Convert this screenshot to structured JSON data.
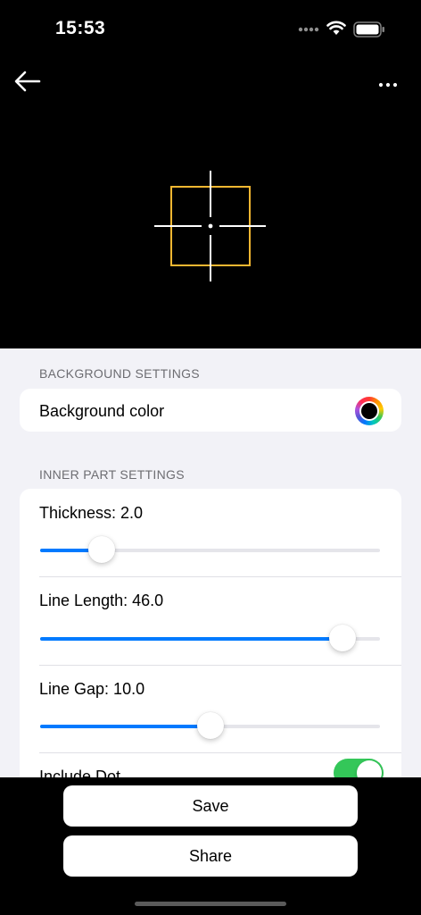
{
  "status_bar": {
    "time": "15:53"
  },
  "background_settings": {
    "header": "BACKGROUND SETTINGS",
    "background_color_label": "Background color",
    "background_color_value": "#000000"
  },
  "inner_part_settings": {
    "header": "INNER PART SETTINGS",
    "sliders": [
      {
        "label": "Thickness: 2.0",
        "fraction": 0.18
      },
      {
        "label": "Line Length: 46.0",
        "fraction": 0.89
      },
      {
        "label": "Line Gap: 10.0",
        "fraction": 0.5
      }
    ],
    "include_dot_label": "Include Dot",
    "include_dot_on": true
  },
  "actions": {
    "save_label": "Save",
    "share_label": "Share"
  },
  "colors": {
    "accent": "#007AFF",
    "toggle_on": "#34C759",
    "crosshair_square": "#F5B731",
    "crosshair_lines": "#FFFFFF"
  }
}
